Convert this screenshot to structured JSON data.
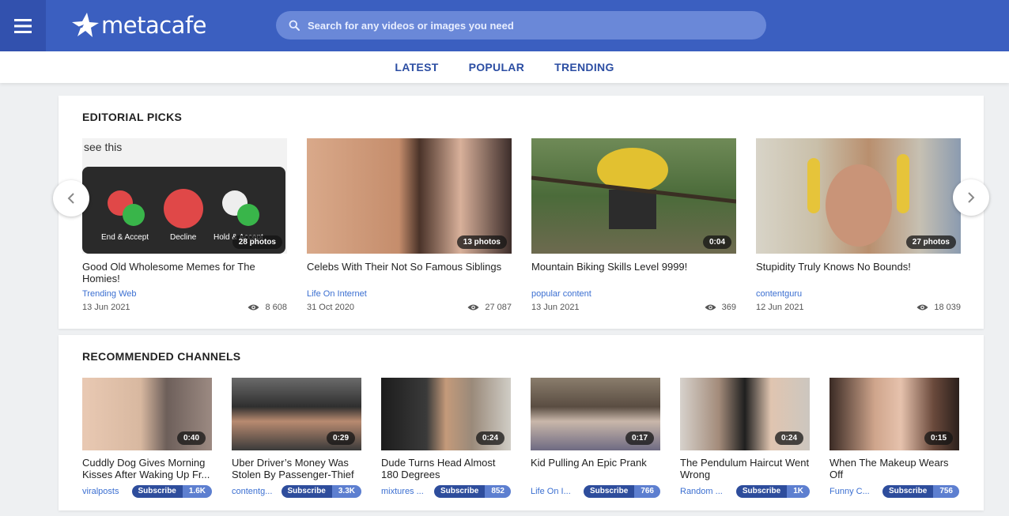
{
  "header": {
    "logo_text": "metacafe",
    "search_placeholder": "Search for any videos or images you need"
  },
  "nav": {
    "items": [
      "LATEST",
      "POPULAR",
      "TRENDING"
    ]
  },
  "editorial": {
    "title": "EDITORIAL PICKS",
    "cards": [
      {
        "title": "Good Old Wholesome Memes for The Homies!",
        "channel": "Trending Web",
        "date": "13 Jun 2021",
        "views": "8 608",
        "badge": "28 photos",
        "thumb_text": {
          "caption": "see this",
          "btn1": "End & Accept",
          "btn2": "Decline",
          "btn3": "Hold & Accept"
        }
      },
      {
        "title": "Celebs With Their Not So Famous Siblings",
        "channel": "Life On Internet",
        "date": "31 Oct 2020",
        "views": "27 087",
        "badge": "13 photos"
      },
      {
        "title": "Mountain Biking Skills Level 9999!",
        "channel": "popular content",
        "date": "13 Jun 2021",
        "views": "369",
        "badge": "0:04"
      },
      {
        "title": "Stupidity Truly Knows No Bounds!",
        "channel": "contentguru",
        "date": "12 Jun 2021",
        "views": "18 039",
        "badge": "27 photos"
      }
    ]
  },
  "channels": {
    "title": "RECOMMENDED CHANNELS",
    "subscribe_label": "Subscribe",
    "cards": [
      {
        "title": "Cuddly Dog Gives Morning Kisses After Waking Up Fr...",
        "channel": "viralposts",
        "subs": "1.6K",
        "duration": "0:40"
      },
      {
        "title": "Uber Driver’s Money Was Stolen By Passenger-Thief",
        "channel": "contentg...",
        "subs": "3.3K",
        "duration": "0:29"
      },
      {
        "title": "Dude Turns Head Almost 180 Degrees",
        "channel": "mixtures ...",
        "subs": "852",
        "duration": "0:24"
      },
      {
        "title": "Kid Pulling An Epic Prank",
        "channel": "Life On I...",
        "subs": "766",
        "duration": "0:17"
      },
      {
        "title": "The Pendulum Haircut Went Wrong",
        "channel": "Random ...",
        "subs": "1K",
        "duration": "0:24"
      },
      {
        "title": "When The Makeup Wears Off",
        "channel": "Funny C...",
        "subs": "756",
        "duration": "0:15"
      }
    ]
  },
  "colors": {
    "header_bg": "#3b5fc0",
    "accent_link": "#3b6fd1",
    "subscribe_dark": "#2e4d9c",
    "subscribe_light": "#5d7fd0"
  },
  "icons": [
    "menu-icon",
    "metacafe-star-logo-icon",
    "search-icon",
    "eye-icon",
    "chevron-left-icon",
    "chevron-right-icon"
  ]
}
